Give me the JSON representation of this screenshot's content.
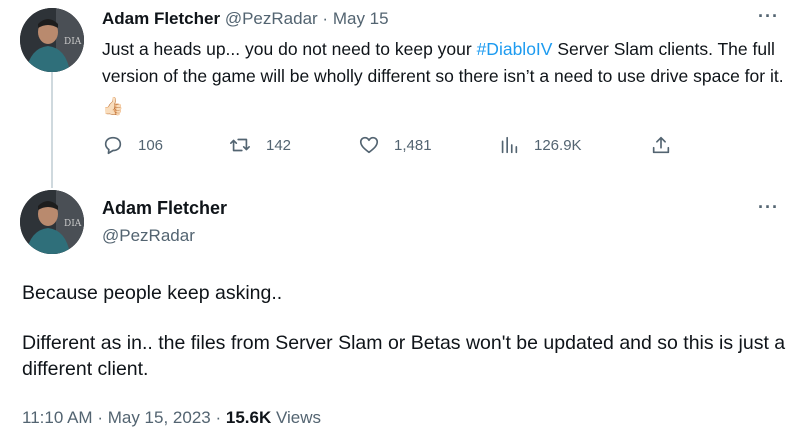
{
  "tweet1": {
    "author_name": "Adam Fletcher",
    "handle": "@PezRadar",
    "separator": "·",
    "date": "May 15",
    "text_before": "Just a heads up... you do not need to keep your ",
    "hashtag": "#DiabloIV",
    "text_after": " Server Slam clients. The full version of the game will be wholly different so there isn’t a need to use drive space for it. ",
    "emoji": "👍🏻",
    "more": "···",
    "actions": {
      "replies": "106",
      "retweets": "142",
      "likes": "1,481",
      "views": "126.9K"
    }
  },
  "tweet2": {
    "author_name": "Adam Fletcher",
    "handle": "@PezRadar",
    "more": "···",
    "paragraph1": "Because people keep asking..",
    "paragraph2": "Different as in.. the files from Server Slam or Betas won't be updated and so this is just a different client.",
    "time": "11:10 AM",
    "separator": "·",
    "date": "May 15, 2023",
    "separator2": "·",
    "views_count": "15.6K",
    "views_label": "Views"
  },
  "avatar_text": "DIA",
  "colors": {
    "text": "#0f1419",
    "muted": "#536471",
    "link": "#1d9bf0",
    "thread_line": "#cfd9de"
  }
}
